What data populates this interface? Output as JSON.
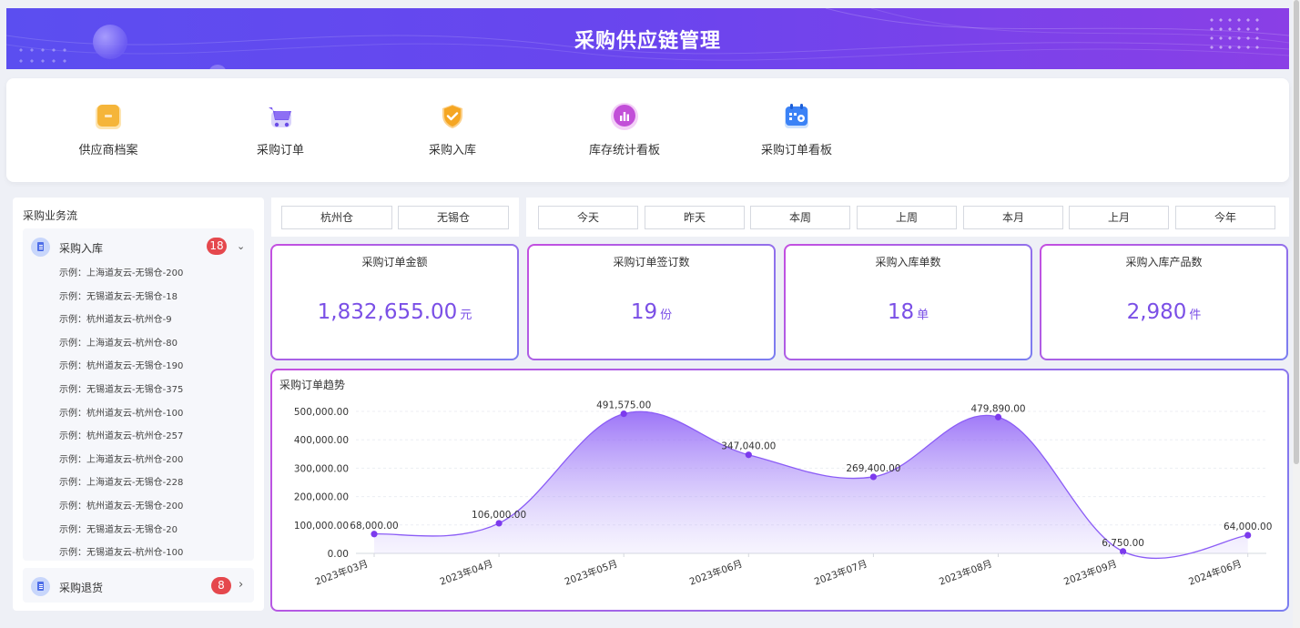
{
  "header": {
    "title": "采购供应链管理"
  },
  "nav": [
    {
      "label": "供应商档案",
      "icon": "folder-icon"
    },
    {
      "label": "采购订单",
      "icon": "cart-icon"
    },
    {
      "label": "采购入库",
      "icon": "shield-check-icon"
    },
    {
      "label": "库存统计看板",
      "icon": "bar-chart-icon"
    },
    {
      "label": "采购订单看板",
      "icon": "calendar-icon"
    }
  ],
  "flow": {
    "title": "采购业务流",
    "inbound": {
      "label": "采购入库",
      "count": "18",
      "items": [
        "示例：上海道友云-无锡仓-200",
        "示例：无锡道友云-无锡仓-18",
        "示例：杭州道友云-杭州仓-9",
        "示例：上海道友云-杭州仓-80",
        "示例：杭州道友云-无锡仓-190",
        "示例：无锡道友云-无锡仓-375",
        "示例：杭州道友云-杭州仓-100",
        "示例：杭州道友云-杭州仓-257",
        "示例：上海道友云-杭州仓-200",
        "示例：上海道友云-无锡仓-228",
        "示例：杭州道友云-无锡仓-200",
        "示例：无锡道友云-无锡仓-20",
        "示例：无锡道友云-杭州仓-100"
      ]
    },
    "returns": {
      "label": "采购退货",
      "count": "8"
    }
  },
  "warehouses": [
    "杭州仓",
    "无锡仓"
  ],
  "periods": [
    "今天",
    "昨天",
    "本周",
    "上周",
    "本月",
    "上月",
    "今年"
  ],
  "stats": [
    {
      "title": "采购订单金额",
      "value": "1,832,655.00",
      "unit": "元"
    },
    {
      "title": "采购订单签订数",
      "value": "19",
      "unit": "份"
    },
    {
      "title": "采购入库单数",
      "value": "18",
      "unit": "单"
    },
    {
      "title": "采购入库产品数",
      "value": "2,980",
      "unit": "件"
    }
  ],
  "chart_title": "采购订单趋势",
  "chart_data": {
    "type": "area",
    "title": "采购订单趋势",
    "categories": [
      "2023年03月",
      "2023年04月",
      "2023年05月",
      "2023年06月",
      "2023年07月",
      "2023年08月",
      "2023年09月",
      "2024年06月"
    ],
    "values": [
      68000,
      106000,
      491575,
      347040,
      269400,
      479890,
      6750,
      64000
    ],
    "data_labels": [
      "68,000.00",
      "106,000.00",
      "491,575.00",
      "347,040.00",
      "269,400.00",
      "479,890.00",
      "6,750.00",
      "64,000.00"
    ],
    "y_ticks": [
      0,
      100000,
      200000,
      300000,
      400000,
      500000
    ],
    "y_tick_labels": [
      "0.00",
      "100,000.00",
      "200,000.00",
      "300,000.00",
      "400,000.00",
      "500,000.00"
    ],
    "ylim": [
      0,
      500000
    ],
    "grid": true,
    "color": "#8b5cf6"
  }
}
